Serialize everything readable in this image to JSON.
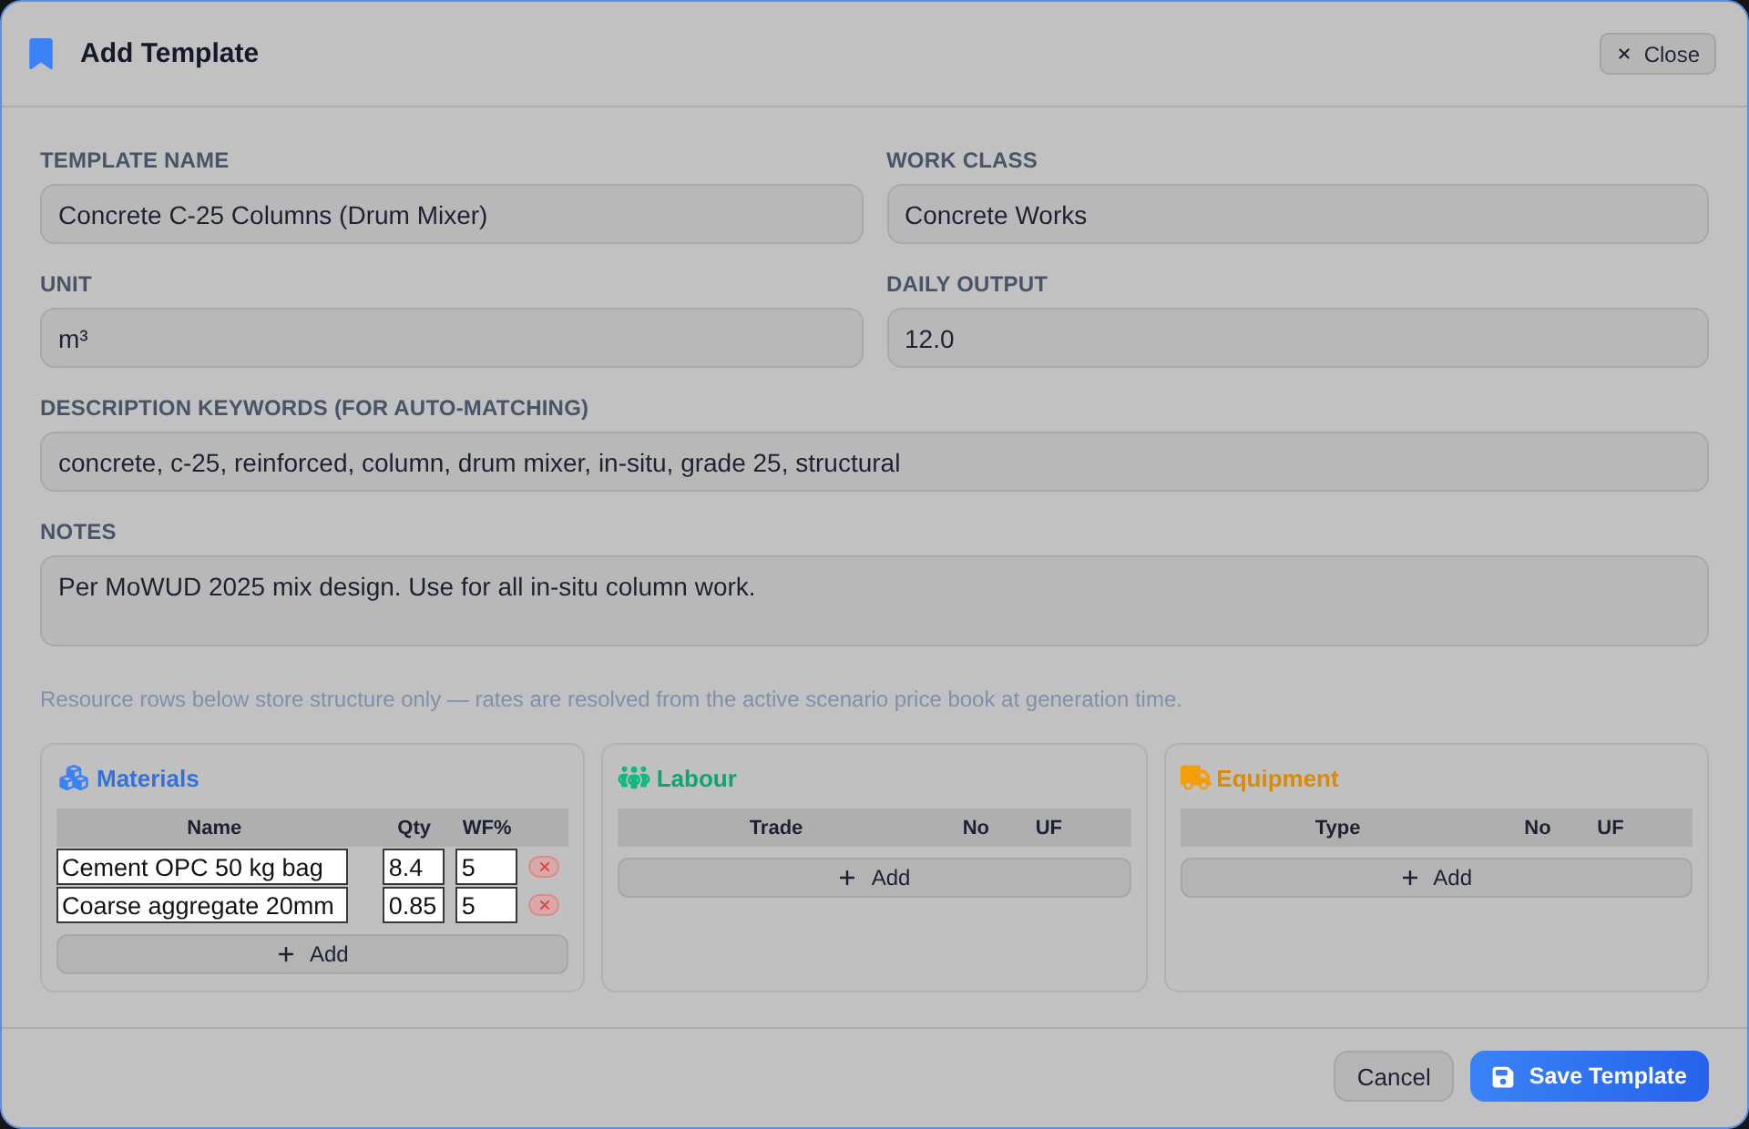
{
  "dialog": {
    "title": "Add Template",
    "close_label": "Close"
  },
  "fields": {
    "template_name": {
      "label": "TEMPLATE NAME",
      "value": "Concrete C-25 Columns (Drum Mixer)"
    },
    "work_class": {
      "label": "WORK CLASS",
      "value": "Concrete Works"
    },
    "unit": {
      "label": "UNIT",
      "value": "m³"
    },
    "daily_output": {
      "label": "DAILY OUTPUT",
      "value": "12.0"
    },
    "description_keywords": {
      "label": "DESCRIPTION KEYWORDS (FOR AUTO-MATCHING)",
      "value": "concrete, c-25, reinforced, column, drum mixer, in-situ, grade 25, structural"
    },
    "notes": {
      "label": "NOTES",
      "value": "Per MoWUD 2025 mix design. Use for all in-situ column work."
    }
  },
  "hint": "Resource rows below store structure only — rates are resolved from the active scenario price book at generation time.",
  "resources": [
    {
      "kind": "materials",
      "title": "Materials",
      "color": "#3b82f6",
      "columns": [
        "Name",
        "Qty",
        "WF%"
      ],
      "rows": [
        {
          "cells": [
            "Cement OPC 50 kg bag",
            "8.4",
            "5"
          ]
        },
        {
          "cells": [
            "Coarse aggregate 20mm",
            "0.85",
            "5"
          ]
        }
      ],
      "add_label": "Add"
    },
    {
      "kind": "labour",
      "title": "Labour",
      "color": "#10b981",
      "columns": [
        "Trade",
        "No",
        "UF"
      ],
      "add_label": "Add"
    },
    {
      "kind": "equipment",
      "title": "Equipment",
      "color": "#f59e0b",
      "columns": [
        "Type",
        "No",
        "UF"
      ],
      "add_label": "Add"
    }
  ],
  "footer": {
    "cancel_label": "Cancel",
    "save_label": "Save Template"
  }
}
